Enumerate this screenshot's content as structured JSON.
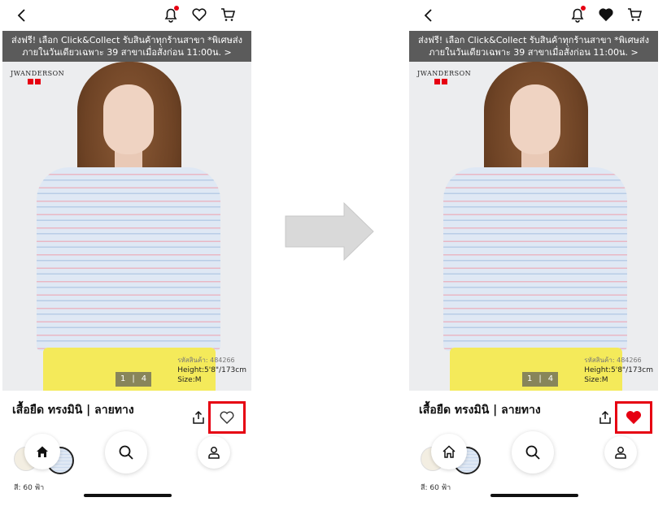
{
  "banner_text": "ส่งฟรี! เลือก Click&Collect รับสินค้าทุกร้านสาขา *พิเศษส่งภายในวันเดียวเฉพาะ 39 สาขาเมื่อสั่งก่อน 11:00น. >",
  "brand": {
    "name": "JWANDERSON",
    "logo": "uniqlo-logo"
  },
  "product": {
    "code_label": "รหัสสินค้า: 484266",
    "height": "Height:5'8\"/173cm",
    "size": "Size:M",
    "image_index": "1",
    "image_total": "4",
    "title": "เสื้อยืด ทรงมินิ | ลายทาง",
    "color_label": "สี: 60 ฟ้า"
  },
  "states": {
    "before": {
      "favorited": false,
      "heart_color": "#333333"
    },
    "after": {
      "favorited": true,
      "heart_color": "#e60012"
    }
  },
  "colors": {
    "accent": "#e60012",
    "banner_bg": "#5b5b5b",
    "arrow": "#d9d9d9"
  },
  "icons": {
    "back": "chevron-left-icon",
    "notification": "bell-icon",
    "wishlist": "heart-icon",
    "cart": "cart-icon",
    "share": "share-icon",
    "home": "home-icon",
    "search": "search-icon",
    "account": "user-icon"
  }
}
